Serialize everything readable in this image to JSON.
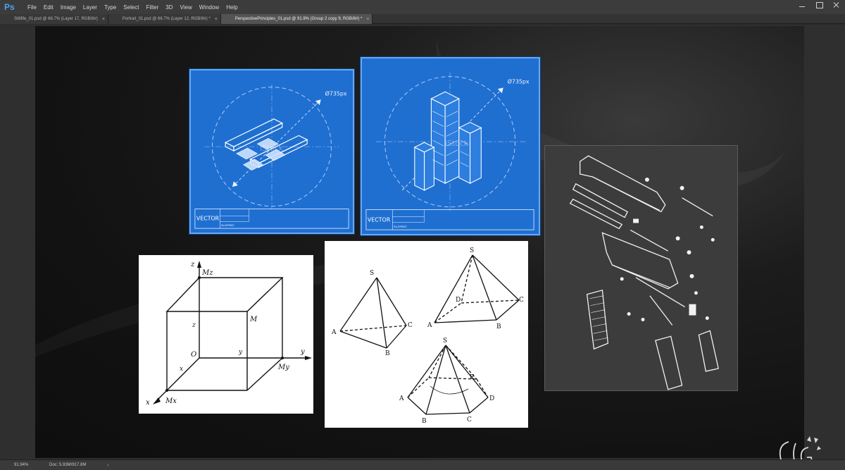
{
  "app": {
    "logo": "Ps"
  },
  "menu": [
    "File",
    "Edit",
    "Image",
    "Layer",
    "Type",
    "Select",
    "Filter",
    "3D",
    "View",
    "Window",
    "Help"
  ],
  "tabs": [
    {
      "label": "Stilllife_01.psd @ 66.7% (Layer 17, RGB/8#)",
      "close": "×"
    },
    {
      "label": "Portrait_01.psd @ 66.7% (Layer 12, RGB/8#) *",
      "close": "×"
    },
    {
      "label": "PerspectivePrinciples_01.psd @ 91.9% (Group 2 copy 9, RGB/8#) *",
      "close": "×"
    }
  ],
  "canvas": {
    "blueprint_rail": {
      "dimension": "Ø735px",
      "vector_label": "VECTOR",
      "title_block": "BLUEPRINT",
      "watermark": "iStock"
    },
    "blueprint_building": {
      "dimension": "Ø735px",
      "vector_label": "VECTOR",
      "title_block": "BLUEPRINT",
      "watermark": "iStock"
    },
    "cube_diagram": {
      "labels": [
        "z",
        "Mz",
        "M",
        "z",
        "O",
        "y",
        "y",
        "My",
        "x",
        "x",
        "Mx"
      ]
    },
    "pyramids": {
      "labels": [
        "S",
        "A",
        "C",
        "B",
        "S",
        "D",
        "C",
        "A",
        "B",
        "S",
        "A",
        "E",
        "D",
        "B",
        "C"
      ]
    }
  },
  "status": {
    "zoom": "91.94%",
    "doc": "Doc: 5.93M/917.8M",
    "arrow": "›"
  }
}
